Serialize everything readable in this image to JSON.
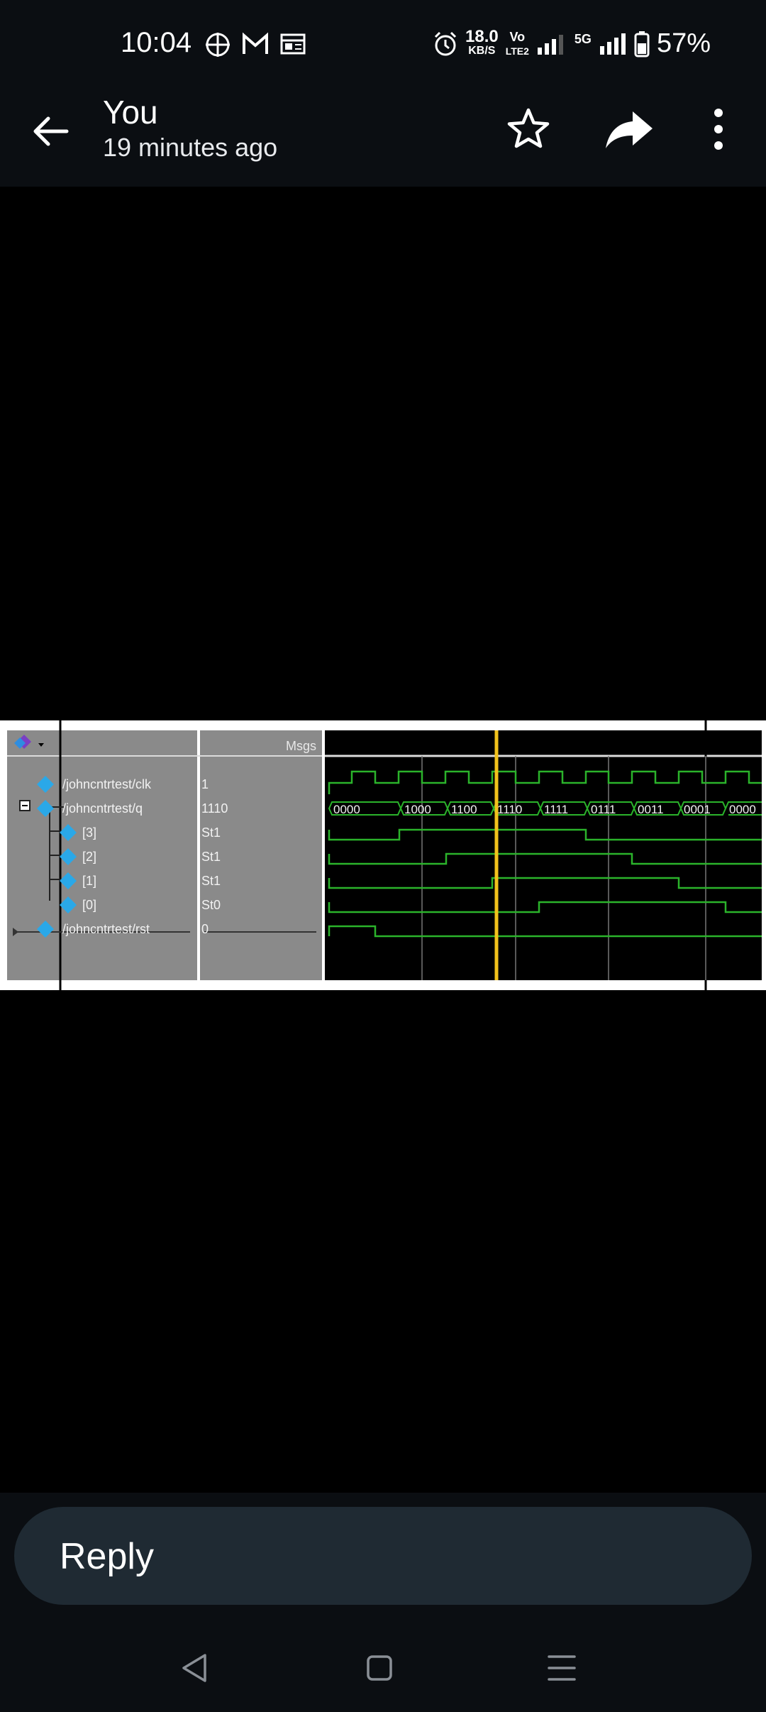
{
  "status_bar": {
    "time": "10:04",
    "speed_value": "18.0",
    "speed_unit": "KB/S",
    "volte_top": "Vo",
    "volte_bottom": "LTE2",
    "network": "5G",
    "battery": "57%"
  },
  "app_bar": {
    "title": "You",
    "subtitle": "19 minutes ago"
  },
  "waveform": {
    "header_value": "Msgs",
    "signals": [
      {
        "name": "/johncntrtest/clk",
        "value": "1"
      },
      {
        "name": "/johncntrtest/q",
        "value": "1110"
      },
      {
        "name": "[3]",
        "value": "St1"
      },
      {
        "name": "[2]",
        "value": "St1"
      },
      {
        "name": "[1]",
        "value": "St1"
      },
      {
        "name": "[0]",
        "value": "St0"
      },
      {
        "name": "/johncntrtest/rst",
        "value": "0"
      }
    ],
    "bus_values": [
      "0000",
      "1000",
      "1100",
      "1110",
      "1111",
      "0111",
      "0011",
      "0001",
      "0000"
    ]
  },
  "reply": {
    "label": "Reply"
  },
  "colors": {
    "bar_bg": "#0b0e12",
    "reply_bg": "#1f2a33",
    "wave_green": "#2bb32b",
    "cursor_yellow": "#f2c21b",
    "panel_gray": "#8a8a8a"
  },
  "icons": {
    "back": "arrow-left-icon",
    "star": "star-outline-icon",
    "share": "share-arrow-icon",
    "more": "more-vertical-icon",
    "nav_back": "triangle-back-icon",
    "nav_home": "square-home-icon",
    "nav_recent": "menu-lines-icon"
  }
}
